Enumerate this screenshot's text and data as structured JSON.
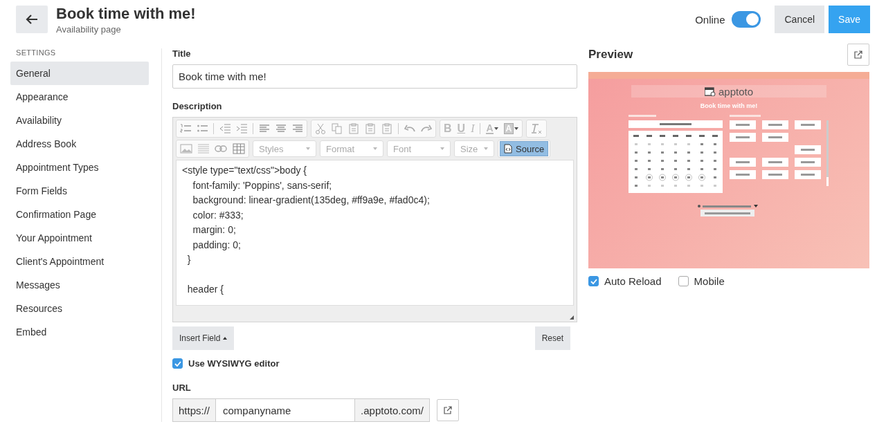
{
  "header": {
    "title": "Book time with me!",
    "subtitle": "Availability page",
    "online_label": "Online",
    "online": true,
    "cancel": "Cancel",
    "save": "Save"
  },
  "sidebar": {
    "heading": "SETTINGS",
    "items": [
      {
        "label": "General",
        "selected": true
      },
      {
        "label": "Appearance",
        "selected": false
      },
      {
        "label": "Availability",
        "selected": false
      },
      {
        "label": "Address Book",
        "selected": false
      },
      {
        "label": "Appointment Types",
        "selected": false
      },
      {
        "label": "Form Fields",
        "selected": false
      },
      {
        "label": "Confirmation Page",
        "selected": false
      },
      {
        "label": "Your Appointment",
        "selected": false
      },
      {
        "label": "Client's Appointment",
        "selected": false
      },
      {
        "label": "Messages",
        "selected": false
      },
      {
        "label": "Resources",
        "selected": false
      },
      {
        "label": "Embed",
        "selected": false
      }
    ]
  },
  "form": {
    "title_label": "Title",
    "title_value": "Book time with me!",
    "description_label": "Description",
    "editor": {
      "format_buttons": [
        "B",
        "U",
        "I"
      ],
      "text_color": "A",
      "background_color": "A",
      "dropdowns": [
        "Styles",
        "Format",
        "Font",
        "Size"
      ],
      "source": "Source",
      "line_blocks": [
        [
          "<style type=\"text/css\">body {",
          "    font-family: 'Poppins', sans-serif;",
          "    background: linear-gradient(135deg, #ff9a9e, #fad0c4);",
          "    color: #333;",
          "    margin: 0;",
          "    padding: 0;",
          "  }"
        ],
        [
          "  header {"
        ]
      ]
    },
    "insert_field": "Insert Field",
    "reset": "Reset",
    "wysiwyg_label": "Use WYSIWYG editor",
    "wysiwyg": true,
    "url_label": "URL",
    "url_prefix": "https://",
    "url_value": "companyname",
    "url_suffix": ".apptoto.com/"
  },
  "preview": {
    "heading": "Preview",
    "auto_reload_label": "Auto Reload",
    "auto_reload": true,
    "mobile_label": "Mobile",
    "mobile": false,
    "page": {
      "logo": "apptoto",
      "title": "Book time with me!"
    }
  }
}
